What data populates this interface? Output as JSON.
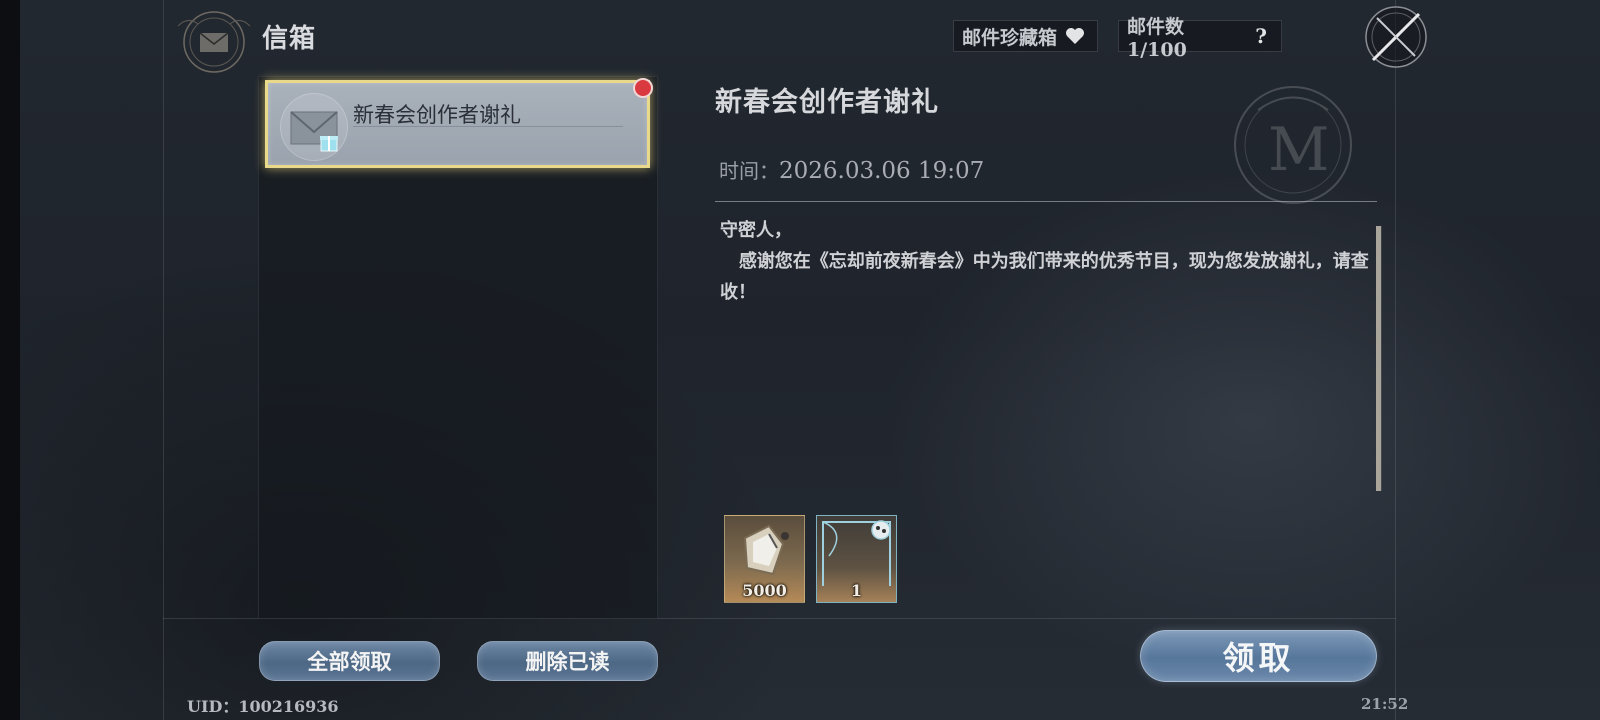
{
  "window": {
    "title": "信箱"
  },
  "top_bar": {
    "favorites_label": "邮件珍藏箱",
    "favorites_icon": "heart-icon",
    "mail_count_label": "邮件数1/100",
    "help_icon": "question-icon",
    "close_icon": "compass-close-icon"
  },
  "mail_list": {
    "items": [
      {
        "title": "新春会创作者谢礼",
        "selected": true,
        "unread": true,
        "has_attachment": true
      }
    ]
  },
  "detail": {
    "title": "新春会创作者谢礼",
    "time_label": "时间：",
    "time_value": "2026.03.06 19:07",
    "body": "守密人，\n   感谢您在《忘却前夜新春会》中为我们带来的优秀节目，现为您发放谢礼，请查收！",
    "rewards": [
      {
        "count": "5000",
        "icon": "currency-shard-icon"
      },
      {
        "count": "1",
        "icon": "frame-card-icon"
      }
    ],
    "claim_label": "领取"
  },
  "actions": {
    "claim_all_label": "全部领取",
    "delete_read_label": "删除已读"
  },
  "footer": {
    "uid": "UID：100216936",
    "clock": "21:52"
  },
  "colors": {
    "background": "#1e232b",
    "selected_border": "#e9d98a",
    "unread_dot": "#d93a3f",
    "button_blue": "#56769a"
  }
}
